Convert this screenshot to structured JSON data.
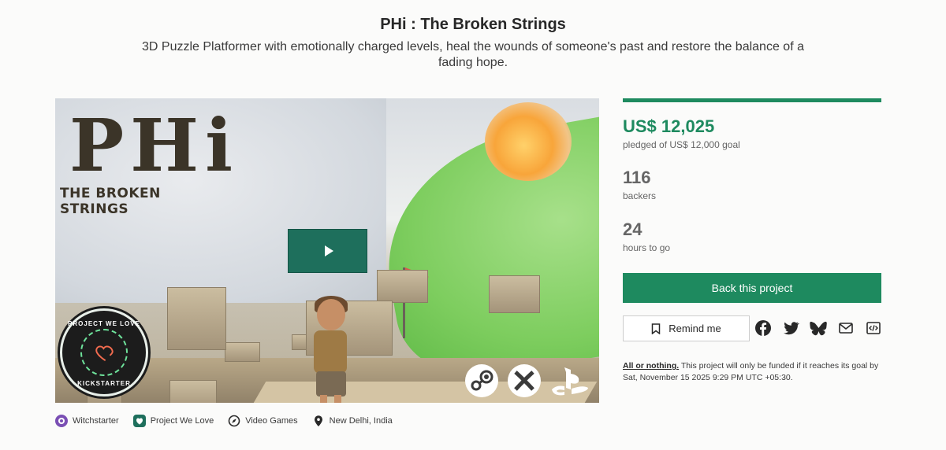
{
  "project": {
    "title": "PHi : The Broken Strings",
    "blurb": "3D Puzzle Platformer with emotionally charged levels, heal the wounds of someone's past and restore the balance of a fading hope."
  },
  "media": {
    "logo_title": "PHi",
    "logo_subtitle": "THE BROKEN STRINGS",
    "badge_top": "PROJECT WE LOVE",
    "badge_bottom": "KICKSTARTER",
    "play_icon": "play-icon",
    "platforms": [
      "steam-icon",
      "xbox-icon",
      "playstation-icon"
    ]
  },
  "funding": {
    "pledged": "US$ 12,025",
    "pledged_sub": "pledged of US$ 12,000 goal",
    "progress_fraction": 1.0,
    "backers_count": "116",
    "backers_label": "backers",
    "time_left": "24",
    "time_label": "hours to go"
  },
  "actions": {
    "back_label": "Back this project",
    "remind_label": "Remind me",
    "share_icons": [
      "facebook-icon",
      "twitter-icon",
      "bluesky-icon",
      "email-icon",
      "embed-icon"
    ]
  },
  "notice": {
    "link": "All or nothing.",
    "text": " This project will only be funded if it reaches its goal by Sat, November 15 2025 9:29 PM UTC +05:30."
  },
  "tags": [
    {
      "icon": "witchstarter-icon",
      "label": "Witchstarter"
    },
    {
      "icon": "project-we-love-icon",
      "label": "Project We Love"
    },
    {
      "icon": "compass-icon",
      "label": "Video Games"
    },
    {
      "icon": "location-pin-icon",
      "label": "New Delhi, India"
    }
  ],
  "colors": {
    "accent": "#1e8a5f",
    "progress": "#05ce78",
    "play_button": "#1e6f5c"
  }
}
